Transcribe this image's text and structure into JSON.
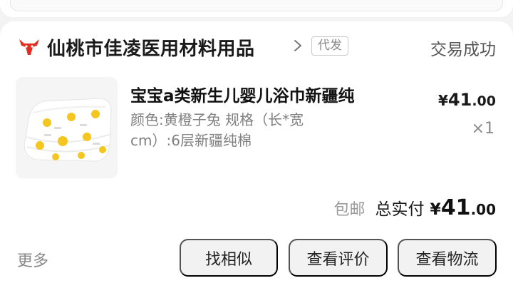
{
  "shop": {
    "name": "仙桃市佳凌医用材料用品",
    "tag": "代发",
    "status": "交易成功"
  },
  "product": {
    "title": "宝宝a类新生儿婴儿浴巾新疆纯",
    "spec": "颜色:黄橙子兔 规格（长*宽cm）:6层新疆纯棉",
    "unit_price": {
      "currency": "¥",
      "integer": "41",
      "decimal": ".00"
    },
    "quantity": "×1"
  },
  "summary": {
    "shipping": "包邮",
    "total_label": "总实付",
    "total_price": {
      "currency": "¥",
      "integer": "41",
      "decimal": ".00"
    }
  },
  "actions": {
    "more": "更多",
    "similar": "找相似",
    "review": "查看评价",
    "logistics": "查看物流"
  },
  "colors": {
    "brand_red": "#e02e24",
    "button_bg": "#f2f2f2",
    "polka_dot": "#f5c61f"
  },
  "icons": {
    "shop_logo": "bull-head-icon",
    "shop_link": "chevron-right-icon"
  }
}
